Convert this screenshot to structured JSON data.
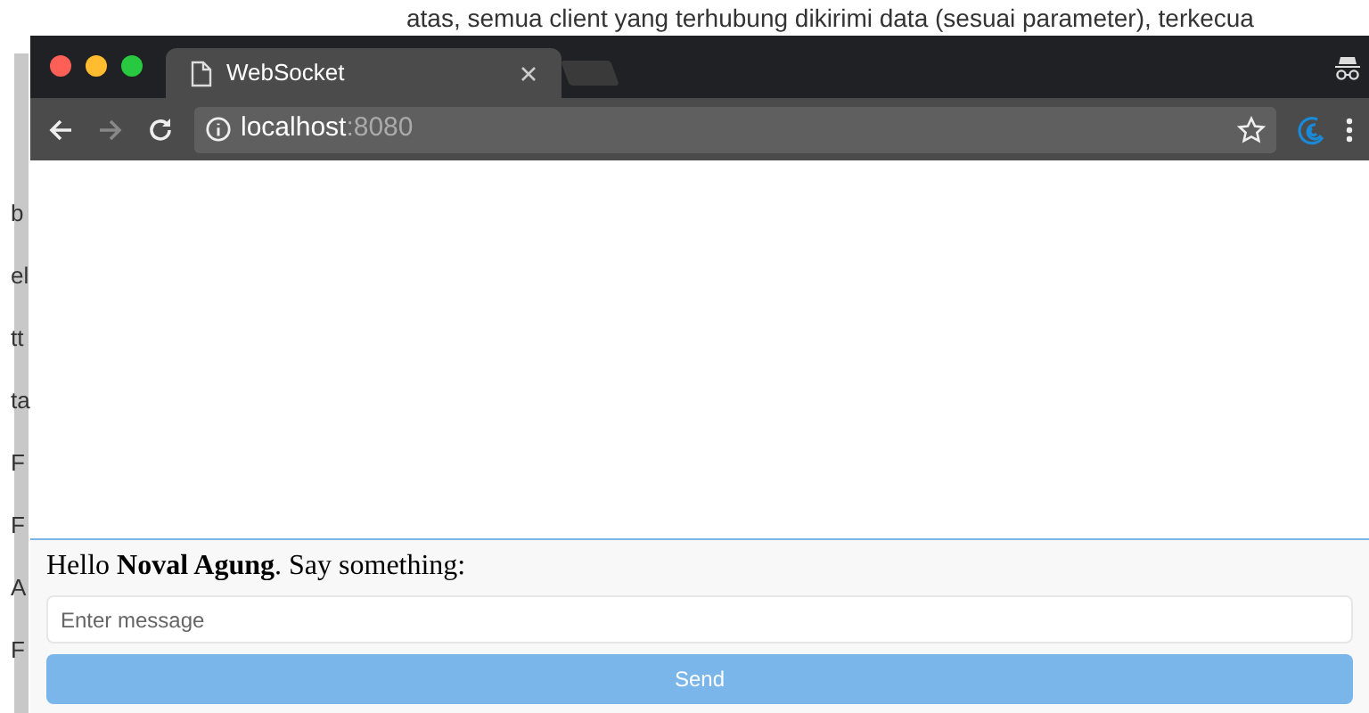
{
  "background_page": {
    "top_text": "atas, semua client yang terhubung dikirimi data (sesuai parameter), terkecua",
    "side_fragments": [
      "b",
      "el",
      "tt",
      "ta",
      "F",
      "F",
      "A",
      "F"
    ]
  },
  "browser": {
    "tabs": [
      {
        "title": "WebSocket",
        "selected": true
      }
    ],
    "address": {
      "host": "localhost",
      "port": ":8080"
    }
  },
  "chat": {
    "greeting": "Hello **Noval Agung**. Say something:",
    "input": {
      "placeholder": "Enter message"
    },
    "send_button": "Send"
  }
}
